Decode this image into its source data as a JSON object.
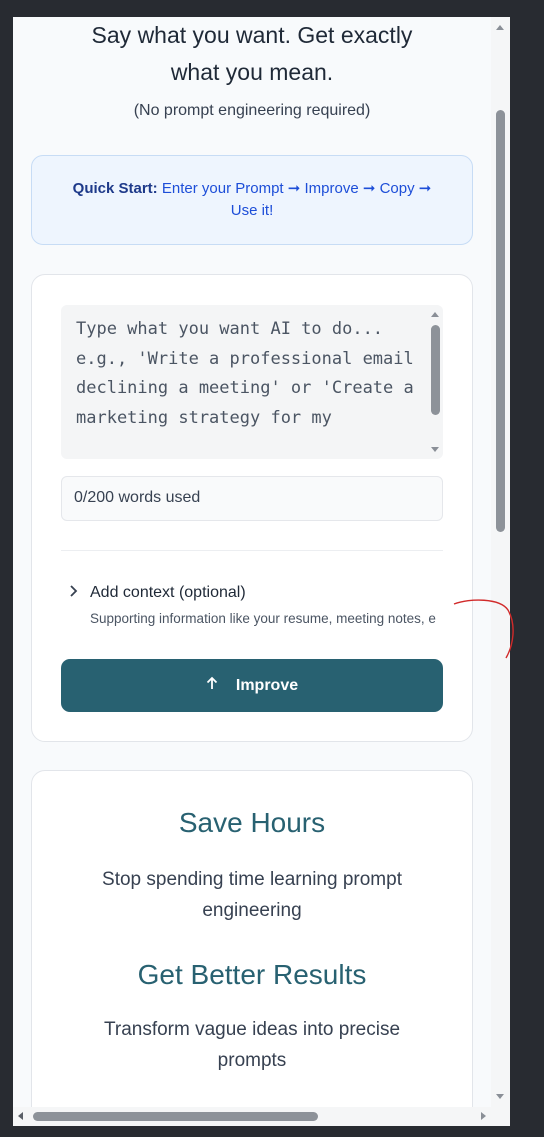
{
  "hero": {
    "line1": "Say what you want. Get exactly",
    "line2": "what you mean.",
    "subnote": "(No prompt engineering required)"
  },
  "quick_start": {
    "label": "Quick Start:",
    "text": "Enter your Prompt ➞ Improve ➞ Copy ➞ Use it!"
  },
  "prompt": {
    "placeholder": "Type what you want AI to do... e.g., 'Write a professional email declining a meeting' or 'Create a marketing strategy for my",
    "word_count": "0/200 words used"
  },
  "context": {
    "title": "Add context (optional)",
    "description": "Supporting information like your resume, meeting notes, e"
  },
  "improve_button": {
    "label": "Improve",
    "icon": "arrow-up-icon"
  },
  "benefits": [
    {
      "title": "Save Hours",
      "description": "Stop spending time learning prompt engineering"
    },
    {
      "title": "Get Better Results",
      "description": "Transform vague ideas into precise prompts"
    }
  ],
  "colors": {
    "accent": "#286171",
    "quick_start_bg": "#eef5fe",
    "quick_start_text": "#1d4ed8",
    "annotation": "#d12a2a"
  }
}
